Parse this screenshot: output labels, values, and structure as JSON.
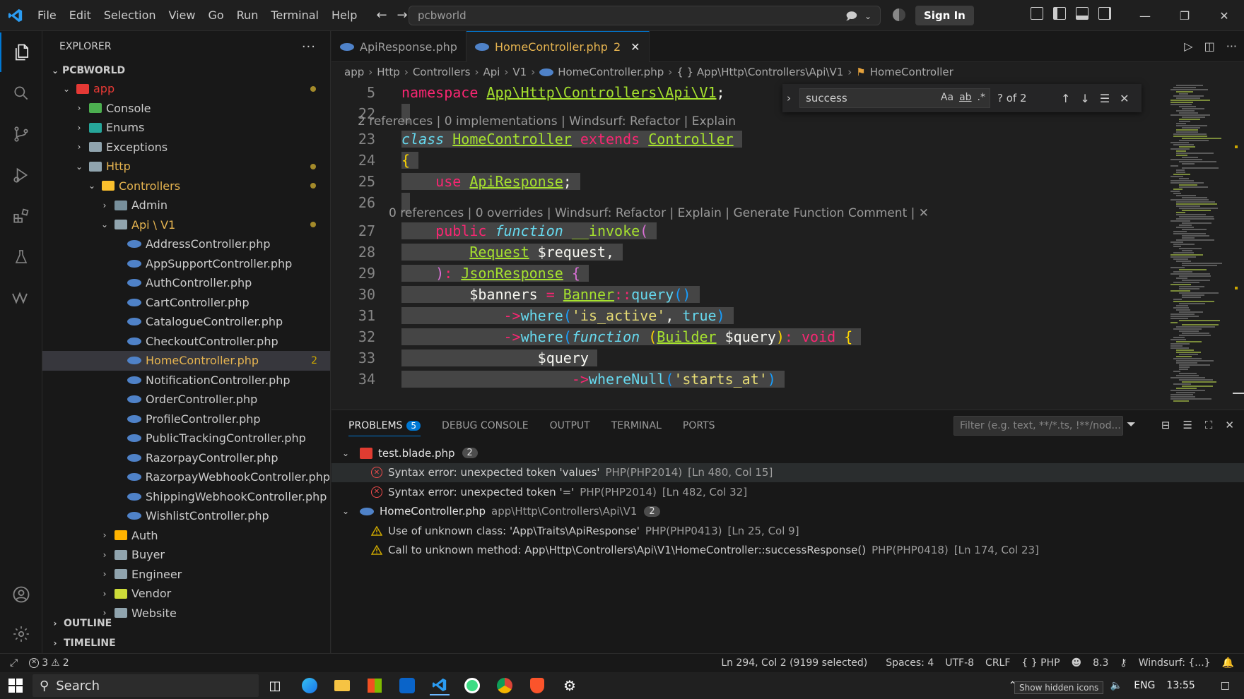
{
  "titlebar": {
    "menu": [
      "File",
      "Edit",
      "Selection",
      "View",
      "Go",
      "Run",
      "Terminal",
      "Help"
    ],
    "search_text": "pcbworld",
    "signin": "Sign In"
  },
  "sidebar": {
    "title": "EXPLORER",
    "project": "PCBWORLD",
    "outline": "OUTLINE",
    "timeline": "TIMELINE",
    "tree": [
      {
        "label": "app",
        "indent": 1,
        "type": "folder-app",
        "open": true,
        "dot": true,
        "color": "#e53935"
      },
      {
        "label": "Console",
        "indent": 2,
        "type": "folder-console",
        "open": false
      },
      {
        "label": "Enums",
        "indent": 2,
        "type": "folder-enums",
        "open": false
      },
      {
        "label": "Exceptions",
        "indent": 2,
        "type": "folder",
        "open": false
      },
      {
        "label": "Http",
        "indent": 2,
        "type": "folder-http",
        "open": true,
        "dot": true,
        "color": "#e6b450"
      },
      {
        "label": "Controllers",
        "indent": 3,
        "type": "folder-ctrl",
        "open": true,
        "dot": true,
        "color": "#e6b450"
      },
      {
        "label": "Admin",
        "indent": 4,
        "type": "folder-admin",
        "open": false
      },
      {
        "label": "Api \\ V1",
        "indent": 4,
        "type": "folder",
        "open": true,
        "dot": true,
        "color": "#e6b450"
      },
      {
        "label": "AddressController.php",
        "indent": 5,
        "type": "php"
      },
      {
        "label": "AppSupportController.php",
        "indent": 5,
        "type": "php"
      },
      {
        "label": "AuthController.php",
        "indent": 5,
        "type": "php"
      },
      {
        "label": "CartController.php",
        "indent": 5,
        "type": "php"
      },
      {
        "label": "CatalogueController.php",
        "indent": 5,
        "type": "php"
      },
      {
        "label": "CheckoutController.php",
        "indent": 5,
        "type": "php"
      },
      {
        "label": "HomeController.php",
        "indent": 5,
        "type": "php",
        "selected": true,
        "badge": "2",
        "color": "#e6b450"
      },
      {
        "label": "NotificationController.php",
        "indent": 5,
        "type": "php"
      },
      {
        "label": "OrderController.php",
        "indent": 5,
        "type": "php"
      },
      {
        "label": "ProfileController.php",
        "indent": 5,
        "type": "php"
      },
      {
        "label": "PublicTrackingController.php",
        "indent": 5,
        "type": "php"
      },
      {
        "label": "RazorpayController.php",
        "indent": 5,
        "type": "php"
      },
      {
        "label": "RazorpayWebhookController.php",
        "indent": 5,
        "type": "php"
      },
      {
        "label": "ShippingWebhookController.php",
        "indent": 5,
        "type": "php"
      },
      {
        "label": "WishlistController.php",
        "indent": 5,
        "type": "php"
      },
      {
        "label": "Auth",
        "indent": 4,
        "type": "folder-auth",
        "open": false
      },
      {
        "label": "Buyer",
        "indent": 4,
        "type": "folder",
        "open": false
      },
      {
        "label": "Engineer",
        "indent": 4,
        "type": "folder",
        "open": false
      },
      {
        "label": "Vendor",
        "indent": 4,
        "type": "folder-vendor",
        "open": false
      },
      {
        "label": "Website",
        "indent": 4,
        "type": "folder",
        "open": false
      }
    ]
  },
  "editor": {
    "tabs": [
      {
        "label": "ApiResponse.php",
        "active": false
      },
      {
        "label": "HomeController.php",
        "active": true,
        "mod": "2"
      }
    ],
    "breadcrumb": [
      "app",
      "Http",
      "Controllers",
      "Api",
      "V1",
      "HomeController.php",
      "{ } App\\Http\\Controllers\\Api\\V1",
      "HomeController"
    ],
    "find": {
      "query": "success",
      "count": "? of 2"
    },
    "lens1": "2 references | 0 implementations | Windsurf: Refactor | Explain",
    "lens2": "0 references | 0 overrides | Windsurf: Refactor | Explain | Generate Function Comment | ✕"
  },
  "panel": {
    "tabs": [
      "PROBLEMS",
      "DEBUG CONSOLE",
      "OUTPUT",
      "TERMINAL",
      "PORTS"
    ],
    "problems_count": "5",
    "filter_placeholder": "Filter (e.g. text, **/*.ts, !**/nod...",
    "groups": [
      {
        "file": "test.blade.php",
        "path": "",
        "count": "2",
        "items": [
          {
            "severity": "error",
            "msg": "Syntax error: unexpected token 'values'",
            "src": "PHP(PHP2014)",
            "loc": "[Ln 480, Col 15]"
          },
          {
            "severity": "error",
            "msg": "Syntax error: unexpected token '='",
            "src": "PHP(PHP2014)",
            "loc": "[Ln 482, Col 32]"
          }
        ]
      },
      {
        "file": "HomeController.php",
        "path": "app\\Http\\Controllers\\Api\\V1",
        "count": "2",
        "items": [
          {
            "severity": "warning",
            "msg": "Use of unknown class: 'App\\Traits\\ApiResponse'",
            "src": "PHP(PHP0413)",
            "loc": "[Ln 25, Col 9]"
          },
          {
            "severity": "warning",
            "msg": "Call to unknown method: App\\Http\\Controllers\\Api\\V1\\HomeController::successResponse()",
            "src": "PHP(PHP0418)",
            "loc": "[Ln 174, Col 23]"
          }
        ]
      }
    ]
  },
  "statusbar": {
    "errors": "3",
    "warnings": "2",
    "position": "Ln 294, Col 2 (9199 selected)",
    "spaces": "Spaces: 4",
    "encoding": "UTF-8",
    "eol": "CRLF",
    "language": "PHP",
    "version": "8.3",
    "windsurf": "Windsurf: {...}"
  },
  "taskbar": {
    "search": "Search",
    "lang": "ENG",
    "time": "13:55",
    "tooltip": "Show hidden icons"
  },
  "colors": {
    "accent": "#0078d4",
    "error": "#f14c4c",
    "warning": "#cca700"
  }
}
